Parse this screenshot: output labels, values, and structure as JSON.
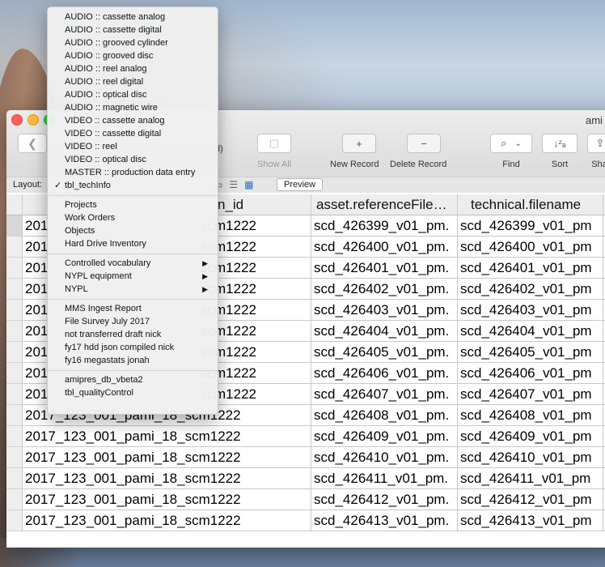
{
  "window": {
    "title": "ami"
  },
  "toolbar": {
    "partial_label": "d)",
    "buttons": [
      {
        "label": "Show All",
        "icon": "▢",
        "disabled": true
      },
      {
        "label": "New Record",
        "icon": "+",
        "disabled": false
      },
      {
        "label": "Delete Record",
        "icon": "−",
        "disabled": false
      },
      {
        "label": "Find",
        "icon": "⌕",
        "disabled": false
      },
      {
        "label": "Sort",
        "icon": "↓ᶻₐ",
        "disabled": false
      },
      {
        "label": "Sha",
        "icon": "⇪",
        "disabled": false
      }
    ]
  },
  "layoutbar": {
    "label": "Layout:",
    "preview": "Preview"
  },
  "table": {
    "headers": [
      "n_id",
      "asset.referenceFile…",
      "technical.filename"
    ],
    "rows": [
      [
        "201",
        "scm1222",
        "scd_426399_v01_pm.",
        "scd_426399_v01_pm"
      ],
      [
        "201",
        "scm1222",
        "scd_426400_v01_pm.",
        "scd_426400_v01_pm"
      ],
      [
        "201",
        "scm1222",
        "scd_426401_v01_pm.",
        "scd_426401_v01_pm"
      ],
      [
        "201",
        "scm1222",
        "scd_426402_v01_pm.",
        "scd_426402_v01_pm"
      ],
      [
        "201",
        "scm1222",
        "scd_426403_v01_pm.",
        "scd_426403_v01_pm"
      ],
      [
        "201",
        "scm1222",
        "scd_426404_v01_pm.",
        "scd_426404_v01_pm"
      ],
      [
        "201",
        "scm1222",
        "scd_426405_v01_pm.",
        "scd_426405_v01_pm"
      ],
      [
        "201",
        "scm1222",
        "scd_426406_v01_pm.",
        "scd_426406_v01_pm"
      ],
      [
        "201",
        "scm1222",
        "scd_426407_v01_pm.",
        "scd_426407_v01_pm"
      ],
      [
        "2017_123_001_pami_18_scm1222",
        "",
        "scd_426408_v01_pm.",
        "scd_426408_v01_pm"
      ],
      [
        "2017_123_001_pami_18_scm1222",
        "",
        "scd_426409_v01_pm.",
        "scd_426409_v01_pm"
      ],
      [
        "2017_123_001_pami_18_scm1222",
        "",
        "scd_426410_v01_pm.",
        "scd_426410_v01_pm"
      ],
      [
        "2017_123_001_pami_18_scm1222",
        "",
        "scd_426411_v01_pm.",
        "scd_426411_v01_pm"
      ],
      [
        "2017_123_001_pami_18_scm1222",
        "",
        "scd_426412_v01_pm.",
        "scd_426412_v01_pm"
      ],
      [
        "2017_123_001_pami_18_scm1222",
        "",
        "scd_426413_v01_pm.",
        "scd_426413_v01_pm"
      ]
    ]
  },
  "menu": {
    "groups": [
      [
        {
          "label": "AUDIO :: cassette analog"
        },
        {
          "label": "AUDIO :: cassette digital"
        },
        {
          "label": "AUDIO :: grooved cylinder"
        },
        {
          "label": "AUDIO :: grooved disc"
        },
        {
          "label": "AUDIO :: reel analog"
        },
        {
          "label": "AUDIO :: reel digital"
        },
        {
          "label": "AUDIO :: optical disc"
        },
        {
          "label": "AUDIO :: magnetic wire"
        },
        {
          "label": "VIDEO :: cassette analog"
        },
        {
          "label": "VIDEO :: cassette digital"
        },
        {
          "label": "VIDEO :: reel"
        },
        {
          "label": "VIDEO :: optical disc"
        },
        {
          "label": "MASTER :: production data entry"
        },
        {
          "label": "tbl_techInfo",
          "checked": true
        }
      ],
      [
        {
          "label": "Projects"
        },
        {
          "label": "Work Orders"
        },
        {
          "label": "Objects"
        },
        {
          "label": "Hard Drive Inventory"
        }
      ],
      [
        {
          "label": "Controlled vocabulary",
          "submenu": true
        },
        {
          "label": "NYPL equipment",
          "submenu": true
        },
        {
          "label": "NYPL",
          "submenu": true
        }
      ],
      [
        {
          "label": "MMS Ingest Report"
        },
        {
          "label": "File Survey July 2017"
        },
        {
          "label": "not transferred draft nick"
        },
        {
          "label": "fy17 hdd json compiled nick"
        },
        {
          "label": "fy16 megastats jonah"
        }
      ],
      [
        {
          "label": "amipres_db_vbeta2"
        },
        {
          "label": "tbl_qualityControl"
        }
      ]
    ],
    "check_glyph": "✓",
    "submenu_glyph": "▶"
  },
  "colors": {
    "close": "#fc605c",
    "minimize": "#fdbc40",
    "zoom": "#34c84a",
    "active_view_icon": "#1a73e8"
  }
}
